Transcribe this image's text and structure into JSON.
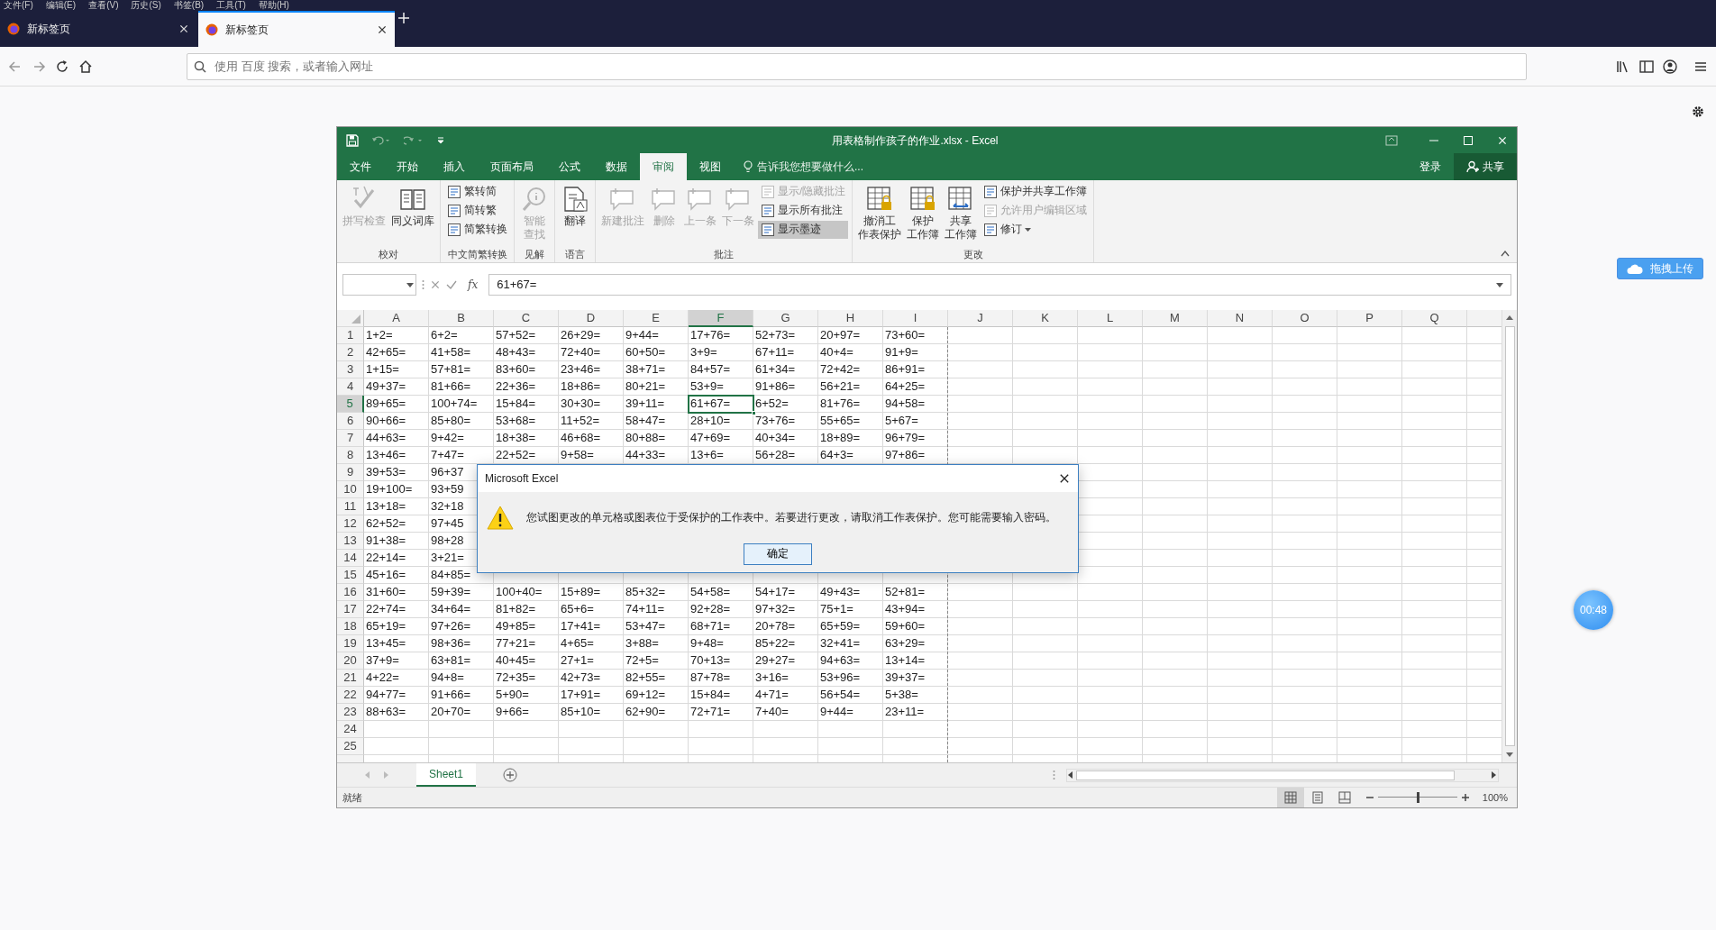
{
  "browser": {
    "menu": [
      "文件(F)",
      "编辑(E)",
      "查看(V)",
      "历史(S)",
      "书签(B)",
      "工具(T)",
      "帮助(H)"
    ],
    "tabs": [
      {
        "label": "新标签页",
        "selected": false
      },
      {
        "label": "新标签页",
        "selected": true
      }
    ],
    "address": {
      "placeholder": "使用 百度 搜索，或者输入网址"
    }
  },
  "excel": {
    "title": "用表格制作孩子的作业.xlsx - Excel",
    "ribbon_tabs": [
      {
        "label": "文件",
        "selected": false
      },
      {
        "label": "开始",
        "selected": false
      },
      {
        "label": "插入",
        "selected": false
      },
      {
        "label": "页面布局",
        "selected": false
      },
      {
        "label": "公式",
        "selected": false
      },
      {
        "label": "数据",
        "selected": false
      },
      {
        "label": "审阅",
        "selected": true
      },
      {
        "label": "视图",
        "selected": false
      }
    ],
    "tell_me": "告诉我您想要做什么...",
    "sign_in": "登录",
    "share": "共享",
    "ribbon_groups": [
      {
        "label": "校对",
        "items": [
          {
            "lines": [
              "拼写检查"
            ],
            "kind": "large",
            "disabled": true
          },
          {
            "lines": [
              "同义词库"
            ],
            "kind": "large",
            "disabled": false
          }
        ]
      },
      {
        "label": "中文简繁转换",
        "items": [
          {
            "label": "繁转简",
            "kind": "small",
            "disabled": false,
            "selected": false
          },
          {
            "label": "简转繁",
            "kind": "small",
            "disabled": false,
            "selected": false
          },
          {
            "label": "简繁转换",
            "kind": "small",
            "disabled": false,
            "selected": false
          }
        ]
      },
      {
        "label": "见解",
        "items": [
          {
            "lines": [
              "智能",
              "查找"
            ],
            "kind": "large",
            "disabled": true
          }
        ]
      },
      {
        "label": "语言",
        "items": [
          {
            "lines": [
              "翻译"
            ],
            "kind": "large",
            "disabled": false
          }
        ]
      },
      {
        "label": "批注",
        "items": [
          {
            "lines": [
              "新建批注"
            ],
            "kind": "large",
            "disabled": true
          },
          {
            "lines": [
              "删除"
            ],
            "kind": "large",
            "disabled": true
          },
          {
            "lines": [
              "上一条"
            ],
            "kind": "large",
            "disabled": true
          },
          {
            "lines": [
              "下一条"
            ],
            "kind": "large",
            "disabled": true
          },
          {
            "label": "显示/隐藏批注",
            "kind": "small",
            "disabled": true,
            "selected": false
          },
          {
            "label": "显示所有批注",
            "kind": "small",
            "disabled": false,
            "selected": false
          },
          {
            "label": "显示墨迹",
            "kind": "small",
            "disabled": false,
            "selected": true
          }
        ]
      },
      {
        "label": "更改",
        "items": [
          {
            "lines": [
              "撤消工",
              "作表保护"
            ],
            "kind": "large",
            "disabled": false
          },
          {
            "lines": [
              "保护",
              "工作簿"
            ],
            "kind": "large",
            "disabled": false
          },
          {
            "lines": [
              "共享",
              "工作簿"
            ],
            "kind": "large",
            "disabled": false
          },
          {
            "label": "保护并共享工作簿",
            "kind": "small",
            "disabled": false,
            "selected": false
          },
          {
            "label": "允许用户编辑区域",
            "kind": "small",
            "disabled": true,
            "selected": false
          },
          {
            "label": "修订",
            "kind": "dropdown",
            "disabled": false,
            "selected": false
          }
        ]
      }
    ],
    "fx_label": "fx",
    "formula": "61+67=",
    "columns": [
      {
        "label": "A",
        "selected": false
      },
      {
        "label": "B",
        "selected": false
      },
      {
        "label": "C",
        "selected": false
      },
      {
        "label": "D",
        "selected": false
      },
      {
        "label": "E",
        "selected": false
      },
      {
        "label": "F",
        "selected": true
      },
      {
        "label": "G",
        "selected": false
      },
      {
        "label": "H",
        "selected": false
      },
      {
        "label": "I",
        "selected": false
      },
      {
        "label": "J",
        "selected": false
      },
      {
        "label": "K",
        "selected": false
      },
      {
        "label": "L",
        "selected": false
      },
      {
        "label": "M",
        "selected": false
      },
      {
        "label": "N",
        "selected": false
      },
      {
        "label": "O",
        "selected": false
      },
      {
        "label": "P",
        "selected": false
      },
      {
        "label": "Q",
        "selected": false
      }
    ],
    "rows": [
      {
        "label": "1",
        "selected": false,
        "cells": [
          "1+2=",
          "6+2=",
          "57+52=",
          "26+29=",
          "9+44=",
          "17+76=",
          "52+73=",
          "20+97=",
          "73+60="
        ]
      },
      {
        "label": "2",
        "selected": false,
        "cells": [
          "42+65=",
          "41+58=",
          "48+43=",
          "72+40=",
          "60+50=",
          "3+9=",
          "67+11=",
          "40+4=",
          "91+9="
        ]
      },
      {
        "label": "3",
        "selected": false,
        "cells": [
          "1+15=",
          "57+81=",
          "83+60=",
          "23+46=",
          "38+71=",
          "84+57=",
          "61+34=",
          "72+42=",
          "86+91="
        ]
      },
      {
        "label": "4",
        "selected": false,
        "cells": [
          "49+37=",
          "81+66=",
          "22+36=",
          "18+86=",
          "80+21=",
          "53+9=",
          "91+86=",
          "56+21=",
          "64+25="
        ]
      },
      {
        "label": "5",
        "selected": true,
        "cells": [
          "89+65=",
          "100+74=",
          "15+84=",
          "30+30=",
          "39+11=",
          "61+67=",
          "6+52=",
          "81+76=",
          "94+58="
        ]
      },
      {
        "label": "6",
        "selected": false,
        "cells": [
          "90+66=",
          "85+80=",
          "53+68=",
          "11+52=",
          "58+47=",
          "28+10=",
          "73+76=",
          "55+65=",
          "5+67="
        ]
      },
      {
        "label": "7",
        "selected": false,
        "cells": [
          "44+63=",
          "9+42=",
          "18+38=",
          "46+68=",
          "80+88=",
          "47+69=",
          "40+34=",
          "18+89=",
          "96+79="
        ]
      },
      {
        "label": "8",
        "selected": false,
        "cells": [
          "13+46=",
          "7+47=",
          "22+52=",
          "9+58=",
          "44+33=",
          "13+6=",
          "56+28=",
          "64+3=",
          "97+86="
        ]
      },
      {
        "label": "9",
        "selected": false,
        "cells": [
          "39+53=",
          "96+37"
        ]
      },
      {
        "label": "10",
        "selected": false,
        "cells": [
          "19+100=",
          "93+59"
        ]
      },
      {
        "label": "11",
        "selected": false,
        "cells": [
          "13+18=",
          "32+18"
        ]
      },
      {
        "label": "12",
        "selected": false,
        "cells": [
          "62+52=",
          "97+45"
        ]
      },
      {
        "label": "13",
        "selected": false,
        "cells": [
          "91+38=",
          "98+28"
        ]
      },
      {
        "label": "14",
        "selected": false,
        "cells": [
          "22+14=",
          "3+21="
        ]
      },
      {
        "label": "15",
        "selected": false,
        "cells": [
          "45+16=",
          "84+85="
        ]
      },
      {
        "label": "16",
        "selected": false,
        "cells": [
          "31+60=",
          "59+39=",
          "100+40=",
          "15+89=",
          "85+32=",
          "54+58=",
          "54+17=",
          "49+43=",
          "52+81="
        ]
      },
      {
        "label": "17",
        "selected": false,
        "cells": [
          "22+74=",
          "34+64=",
          "81+82=",
          "65+6=",
          "74+11=",
          "92+28=",
          "97+32=",
          "75+1=",
          "43+94="
        ]
      },
      {
        "label": "18",
        "selected": false,
        "cells": [
          "65+19=",
          "97+26=",
          "49+85=",
          "17+41=",
          "53+47=",
          "68+71=",
          "20+78=",
          "65+59=",
          "59+60="
        ]
      },
      {
        "label": "19",
        "selected": false,
        "cells": [
          "13+45=",
          "98+36=",
          "77+21=",
          "4+65=",
          "3+88=",
          "9+48=",
          "85+22=",
          "32+41=",
          "63+29="
        ]
      },
      {
        "label": "20",
        "selected": false,
        "cells": [
          "37+9=",
          "63+81=",
          "40+45=",
          "27+1=",
          "72+5=",
          "70+13=",
          "29+27=",
          "94+63=",
          "13+14="
        ]
      },
      {
        "label": "21",
        "selected": false,
        "cells": [
          "4+22=",
          "94+8=",
          "72+35=",
          "42+73=",
          "82+55=",
          "87+78=",
          "3+16=",
          "53+96=",
          "39+37="
        ]
      },
      {
        "label": "22",
        "selected": false,
        "cells": [
          "94+77=",
          "91+66=",
          "5+90=",
          "17+91=",
          "69+12=",
          "15+84=",
          "4+71=",
          "56+54=",
          "5+38="
        ]
      },
      {
        "label": "23",
        "selected": false,
        "cells": [
          "88+63=",
          "20+70=",
          "9+66=",
          "85+10=",
          "62+90=",
          "72+71=",
          "7+40=",
          "9+44=",
          "23+11="
        ]
      },
      {
        "label": "24",
        "selected": false
      },
      {
        "label": "25",
        "selected": false
      }
    ],
    "sheet_tabs": [
      {
        "label": "Sheet1",
        "selected": true
      }
    ],
    "status": "就绪",
    "views": [
      {
        "selected": true
      },
      {
        "selected": false
      },
      {
        "selected": false
      }
    ],
    "zoom_slider": {
      "level": 0.5
    },
    "zoom": "100%"
  },
  "dialog": {
    "title": "Microsoft Excel",
    "message": "您试图更改的单元格或图表位于受保护的工作表中。若要进行更改，请取消工作表保护。您可能需要输入密码。",
    "ok": "确定"
  },
  "upload_button": "拖拽上传",
  "timer": "00:48"
}
